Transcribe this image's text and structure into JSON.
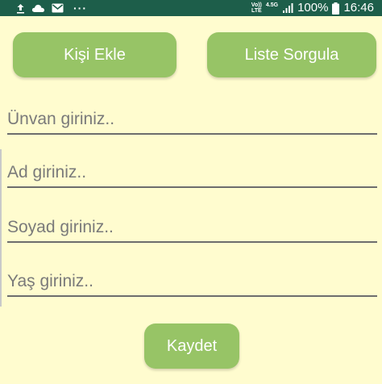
{
  "status_bar": {
    "volte_top": "Vo))",
    "volte_bottom": "LTE",
    "network": "4.5G",
    "battery_percent": "100%",
    "time": "16:46",
    "icons": [
      "upload-icon",
      "cloud-icon",
      "mail-icon",
      "more-dots-icon",
      "volte-icon",
      "signal-icon",
      "battery-icon"
    ],
    "background_color": "#1d5e4a"
  },
  "top_buttons": {
    "add_person_label": "Kişi Ekle",
    "query_list_label": "Liste Sorgula"
  },
  "form": {
    "title_placeholder": "Ünvan giriniz..",
    "name_placeholder": "Ad giriniz..",
    "surname_placeholder": "Soyad giriniz..",
    "age_placeholder": "Yaş giriniz.."
  },
  "actions": {
    "save_label": "Kaydet"
  },
  "colors": {
    "background": "#fffccf",
    "button": "#97c466",
    "button_text": "#ffffff"
  }
}
